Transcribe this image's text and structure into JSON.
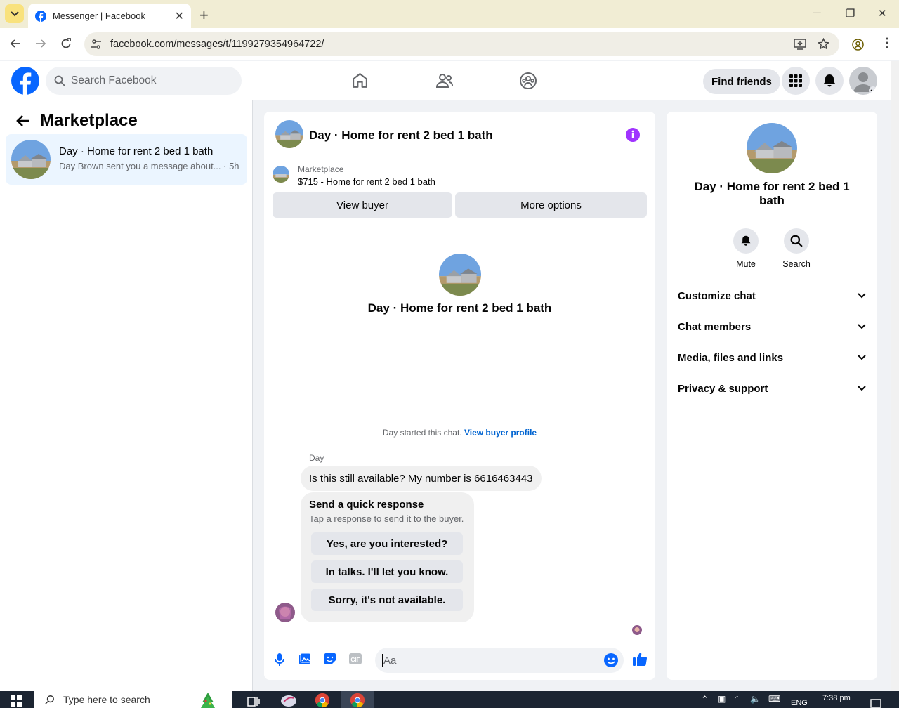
{
  "browser": {
    "tab_title": "Messenger | Facebook",
    "url": "facebook.com/messages/t/1199279354964722/"
  },
  "topbar": {
    "search_placeholder": "Search Facebook",
    "find_friends": "Find friends",
    "brand_color": "#0866ff"
  },
  "sidebar": {
    "title": "Marketplace",
    "conversations": [
      {
        "name": "Day · Home for rent 2 bed 1 bath",
        "snippet": "Day Brown sent you a message about...",
        "time": "· 5h"
      }
    ]
  },
  "chat": {
    "header_title": "Day · Home for rent 2 bed 1 bath",
    "marketplace_label": "Marketplace",
    "listing": "$715 - Home for rent 2 bed 1 bath",
    "view_buyer": "View buyer",
    "more_options": "More options",
    "center_title": "Day · Home for rent 2 bed 1 bath",
    "started_text": "Day started this chat.",
    "view_buyer_profile": "View buyer profile",
    "sender_name": "Day",
    "message": "Is this still available? My number is 6616463443",
    "quick_title": "Send a quick response",
    "quick_sub": "Tap a response to send it to the buyer.",
    "quick_options": [
      "Yes, are you interested?",
      "In talks. I'll let you know.",
      "Sorry, it's not available."
    ],
    "input_placeholder": "Aa",
    "accent_color": "#0866ff"
  },
  "info_panel": {
    "title": "Day · Home for rent 2 bed 1 bath",
    "mute": "Mute",
    "search": "Search",
    "sections": [
      "Customize chat",
      "Chat members",
      "Media, files and links",
      "Privacy & support"
    ]
  },
  "taskbar": {
    "search_placeholder": "Type here to search",
    "language": "ENG",
    "time": "7:38 pm"
  }
}
